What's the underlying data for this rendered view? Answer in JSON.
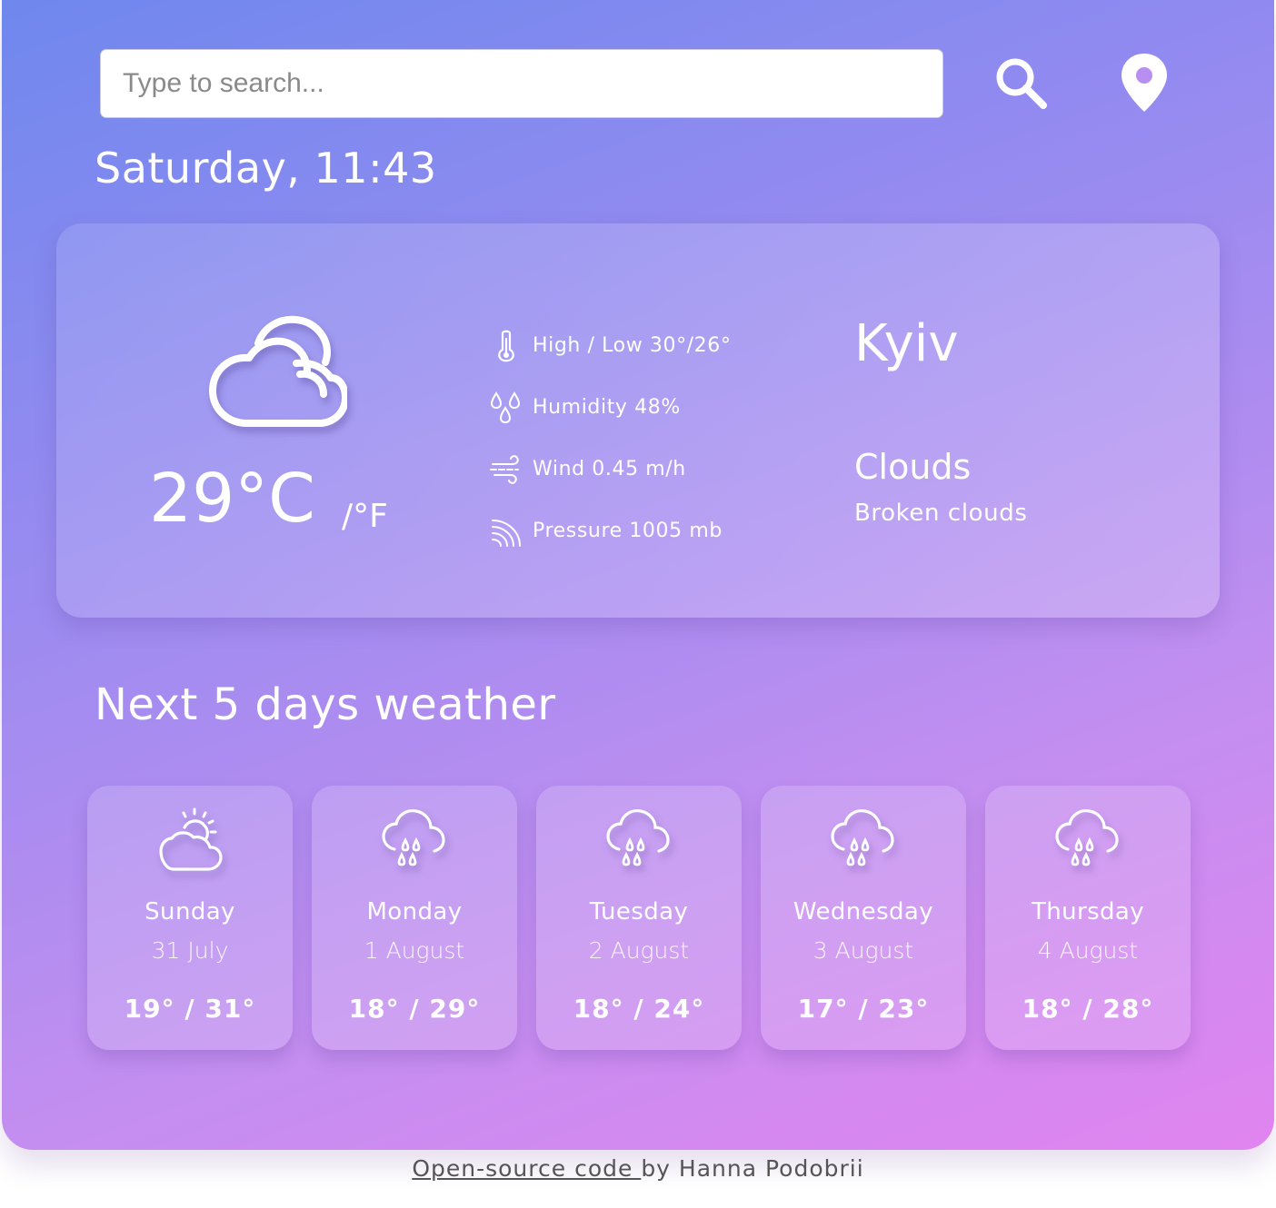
{
  "search": {
    "placeholder": "Type to search..."
  },
  "header": {
    "search_icon": "search-icon",
    "location_icon": "location-pin-icon",
    "date_time": "Saturday, 11:43"
  },
  "current": {
    "icon": "cloud-icon",
    "temperature": "29°C",
    "unit_toggle": "/°F",
    "high_low": "High / Low 30°/26°",
    "humidity": "Humidity 48%",
    "wind": "Wind 0.45 m/h",
    "pressure": "Pressure 1005 mb",
    "city": "Kyiv",
    "condition": "Clouds",
    "description": "Broken clouds"
  },
  "forecast": {
    "title": "Next 5 days weather",
    "days": [
      {
        "name": "Sunday",
        "date": "31 July",
        "temp": "19° / 31°",
        "icon": "sun-cloud-icon"
      },
      {
        "name": "Monday",
        "date": "1 August",
        "temp": "18° / 29°",
        "icon": "rain-cloud-icon"
      },
      {
        "name": "Tuesday",
        "date": "2 August",
        "temp": "18° / 24°",
        "icon": "rain-cloud-icon"
      },
      {
        "name": "Wednesday",
        "date": "3 August",
        "temp": "17° / 23°",
        "icon": "rain-cloud-icon"
      },
      {
        "name": "Thursday",
        "date": "4 August",
        "temp": "18° / 28°",
        "icon": "rain-cloud-icon"
      }
    ]
  },
  "footer": {
    "link_text": "Open-source code ",
    "author_text": "by Hanna Podobrii"
  },
  "colors": {
    "gradient_start": "#6f88ee",
    "gradient_end": "#e184f0",
    "text": "#ffffff"
  }
}
